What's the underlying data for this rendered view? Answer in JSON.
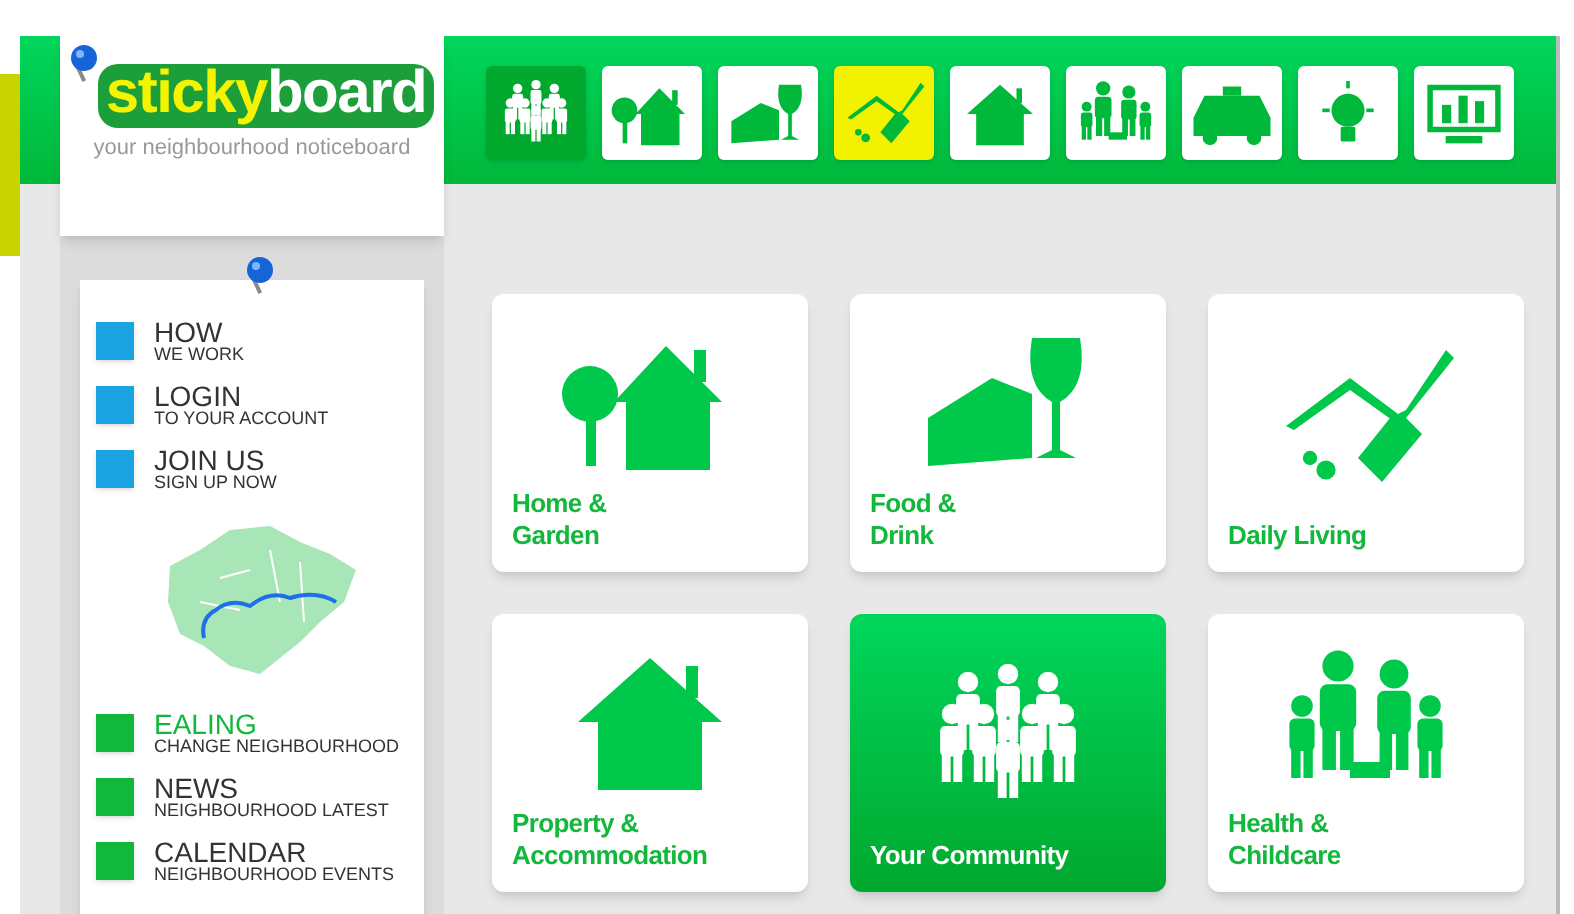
{
  "logo": {
    "word_1": "sticky",
    "word_2": "board",
    "tagline": "your neighbourhood noticeboard"
  },
  "nav": [
    {
      "kind": "community",
      "selected": true,
      "highlighted": false
    },
    {
      "kind": "home",
      "selected": false,
      "highlighted": false
    },
    {
      "kind": "food",
      "selected": false,
      "highlighted": false
    },
    {
      "kind": "living",
      "selected": false,
      "highlighted": true
    },
    {
      "kind": "property",
      "selected": false,
      "highlighted": false
    },
    {
      "kind": "family",
      "selected": false,
      "highlighted": false
    },
    {
      "kind": "taxi",
      "selected": false,
      "highlighted": false
    },
    {
      "kind": "bulb",
      "selected": false,
      "highlighted": false
    },
    {
      "kind": "chart",
      "selected": false,
      "highlighted": false
    }
  ],
  "sidebar": {
    "items_top": [
      {
        "title": "HOW",
        "subtitle": "WE WORK",
        "color": "#1aa3e0",
        "selected": false
      },
      {
        "title": "LOGIN",
        "subtitle": "TO YOUR ACCOUNT",
        "color": "#1aa3e0",
        "selected": false
      },
      {
        "title": "JOIN US",
        "subtitle": "SIGN UP NOW",
        "color": "#1aa3e0",
        "selected": false
      }
    ],
    "items_bottom": [
      {
        "title": "EALING",
        "subtitle": "CHANGE NEIGHBOURHOOD",
        "color": "#12b83c",
        "selected": true
      },
      {
        "title": "NEWS",
        "subtitle": "NEIGHBOURHOOD LATEST",
        "color": "#12b83c",
        "selected": false
      },
      {
        "title": "CALENDAR",
        "subtitle": "NEIGHBOURHOOD EVENTS",
        "color": "#12b83c",
        "selected": false
      }
    ]
  },
  "tiles": [
    {
      "kind": "home",
      "label": "Home &\nGarden",
      "selected": false
    },
    {
      "kind": "food",
      "label": "Food &\nDrink",
      "selected": false
    },
    {
      "kind": "living",
      "label": "Daily Living",
      "selected": false
    },
    {
      "kind": "property",
      "label": "Property &\nAccommodation",
      "selected": false
    },
    {
      "kind": "community",
      "label": "Your Community",
      "selected": true
    },
    {
      "kind": "family",
      "label": "Health &\nChildcare",
      "selected": false
    }
  ]
}
